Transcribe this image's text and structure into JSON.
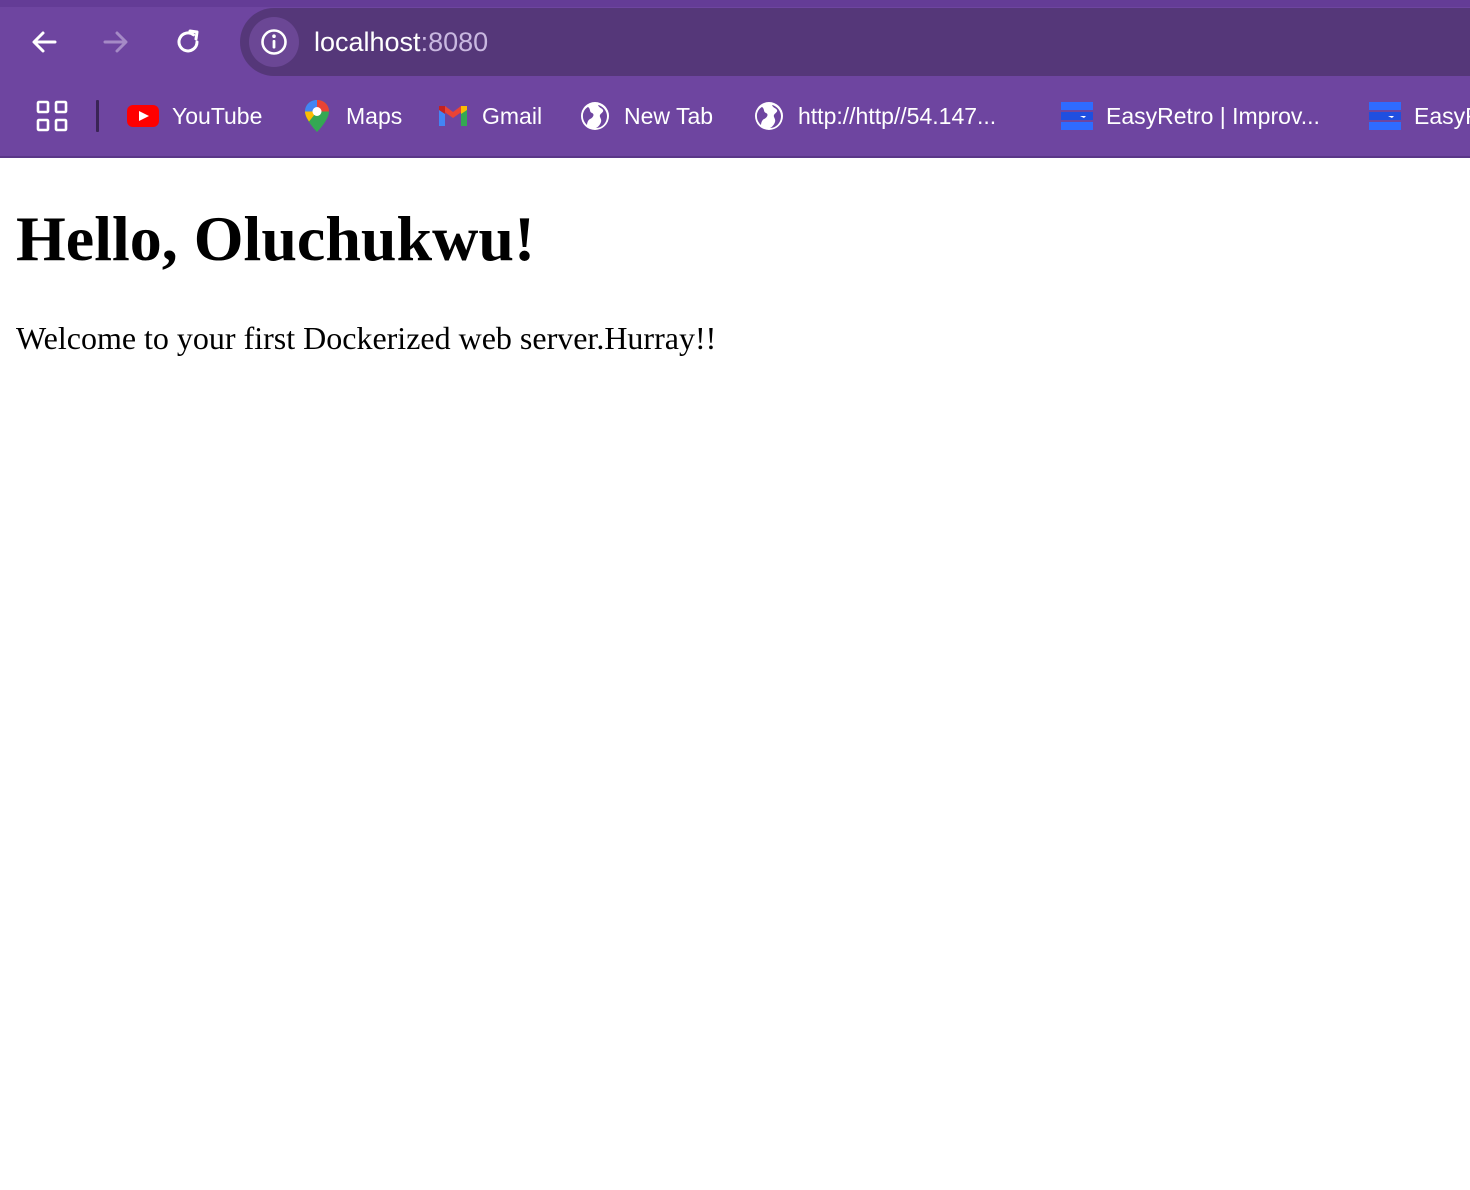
{
  "browser": {
    "url_host": "localhost",
    "url_port": ":8080",
    "colors": {
      "chrome": "#6e45a0",
      "omnibox": "#553779",
      "port_text": "#c9b8e0"
    }
  },
  "nav": {
    "back_icon": "arrow-left-icon",
    "forward_icon": "arrow-right-icon",
    "reload_icon": "reload-icon",
    "info_icon": "info-icon"
  },
  "bookmarks": [
    {
      "label": "YouTube",
      "icon": "youtube-icon"
    },
    {
      "label": "Maps",
      "icon": "maps-pin-icon"
    },
    {
      "label": "Gmail",
      "icon": "gmail-icon"
    },
    {
      "label": "New Tab",
      "icon": "globe-icon"
    },
    {
      "label": "http://http//54.147...",
      "icon": "globe-icon"
    },
    {
      "label": "EasyRetro | Improv...",
      "icon": "easyretro-icon"
    },
    {
      "label": "EasyRetro",
      "icon": "easyretro-icon"
    }
  ],
  "page": {
    "heading": "Hello, Oluchukwu!",
    "paragraph": "Welcome to your first Dockerized web server.Hurray!!"
  }
}
